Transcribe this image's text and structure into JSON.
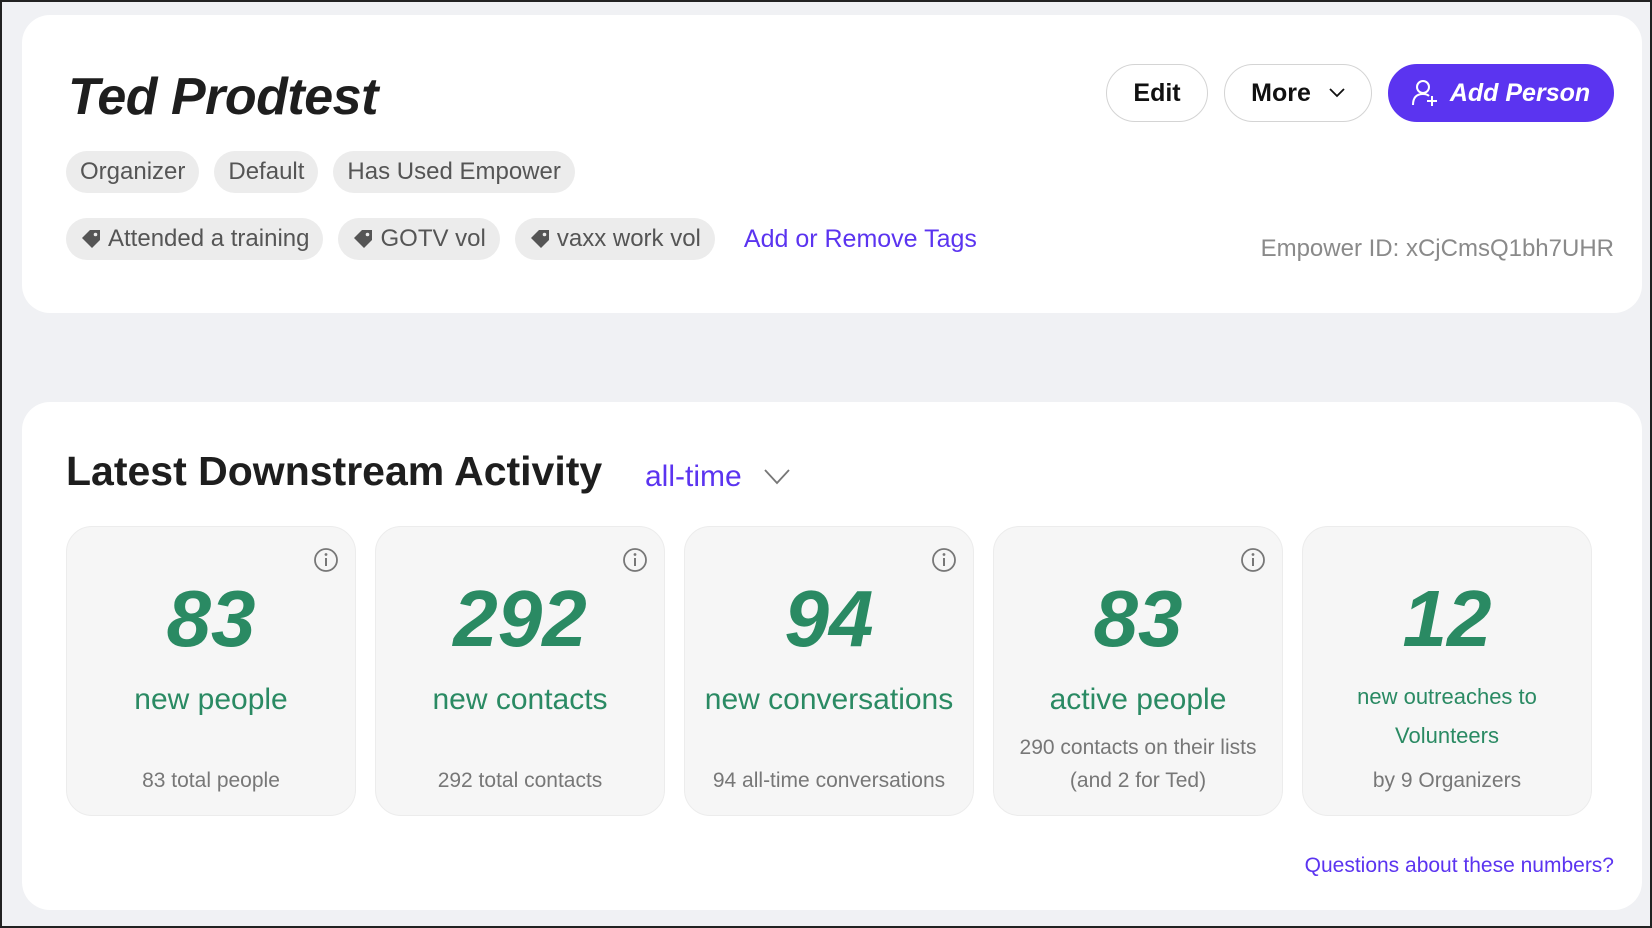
{
  "profile": {
    "name": "Ted Prodtest",
    "roles": [
      "Organizer",
      "Default",
      "Has Used Empower"
    ],
    "tags": [
      "Attended a training",
      "GOTV vol",
      "vaxx work vol"
    ],
    "tags_link": "Add or Remove Tags",
    "empower_id": "Empower ID: xCjCmsQ1bh7UHR",
    "buttons": {
      "edit": "Edit",
      "more": "More",
      "add_person": "Add Person"
    }
  },
  "activity": {
    "title": "Latest Downstream Activity",
    "range": "all-time",
    "stats": [
      {
        "value": "83",
        "label": "new people",
        "footer": "83 total people",
        "info": true
      },
      {
        "value": "292",
        "label": "new contacts",
        "footer": "292 total contacts",
        "info": true
      },
      {
        "value": "94",
        "label": "new conversations",
        "footer": "94 all-time conversations",
        "info": true
      },
      {
        "value": "83",
        "label": "active people",
        "footer": "290 contacts on their lists (and 2 for Ted)",
        "info": true
      },
      {
        "value": "12",
        "label": "new outreaches to Volunteers",
        "footer": "by 9 Organizers",
        "info": false
      }
    ],
    "questions_link": "Questions about these numbers?"
  },
  "colors": {
    "accent": "#5b34f0",
    "stat_green": "#2a8a63",
    "background": "#f0f1f4"
  },
  "icons": {
    "tag": "tag-icon",
    "info": "info-icon",
    "chevron": "chevron-down-icon",
    "person": "add-person-icon"
  }
}
